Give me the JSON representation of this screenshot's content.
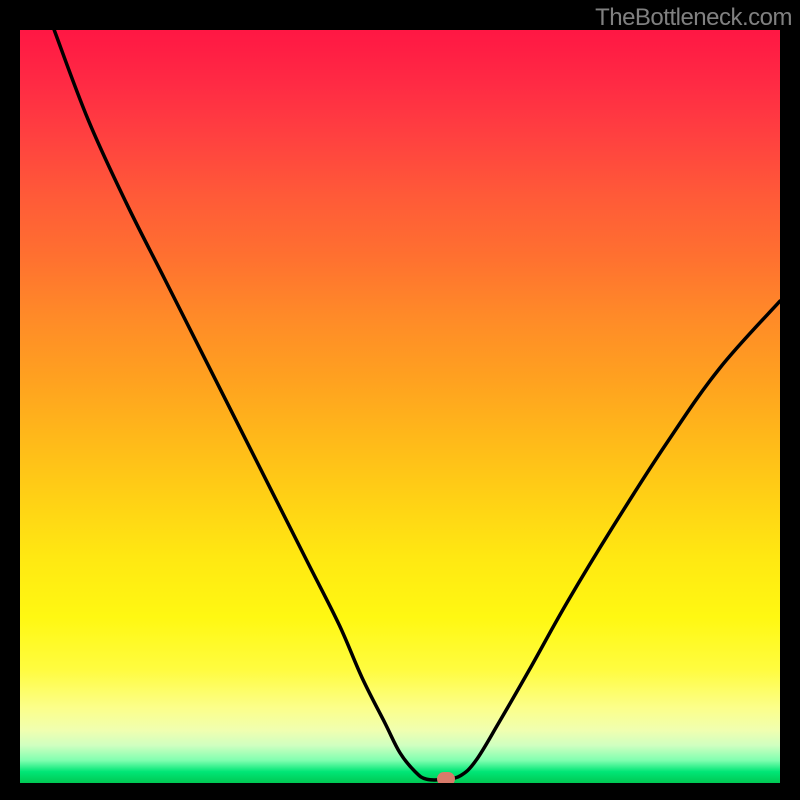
{
  "attribution": "TheBottleneck.com",
  "chart_data": {
    "type": "line",
    "title": "",
    "xlabel": "",
    "ylabel": "",
    "x_range": [
      0,
      100
    ],
    "y_range": [
      0,
      100
    ],
    "curve_points": [
      {
        "x": 4.5,
        "y": 100
      },
      {
        "x": 9,
        "y": 88
      },
      {
        "x": 14,
        "y": 77
      },
      {
        "x": 19,
        "y": 67
      },
      {
        "x": 24,
        "y": 57
      },
      {
        "x": 29,
        "y": 47
      },
      {
        "x": 34,
        "y": 37
      },
      {
        "x": 38,
        "y": 29
      },
      {
        "x": 42,
        "y": 21
      },
      {
        "x": 45,
        "y": 14
      },
      {
        "x": 48,
        "y": 8
      },
      {
        "x": 50,
        "y": 4
      },
      {
        "x": 52,
        "y": 1.5
      },
      {
        "x": 53.5,
        "y": 0.5
      },
      {
        "x": 56,
        "y": 0.5
      },
      {
        "x": 58,
        "y": 1
      },
      {
        "x": 60,
        "y": 3
      },
      {
        "x": 63,
        "y": 8
      },
      {
        "x": 67,
        "y": 15
      },
      {
        "x": 72,
        "y": 24
      },
      {
        "x": 78,
        "y": 34
      },
      {
        "x": 85,
        "y": 45
      },
      {
        "x": 92,
        "y": 55
      },
      {
        "x": 100,
        "y": 64
      }
    ],
    "marker": {
      "x": 56,
      "y": 0.5,
      "color": "#d87a6a"
    },
    "gradient": {
      "top": "#ff1744",
      "mid": "#ffeb3b",
      "bottom": "#00c853"
    }
  }
}
